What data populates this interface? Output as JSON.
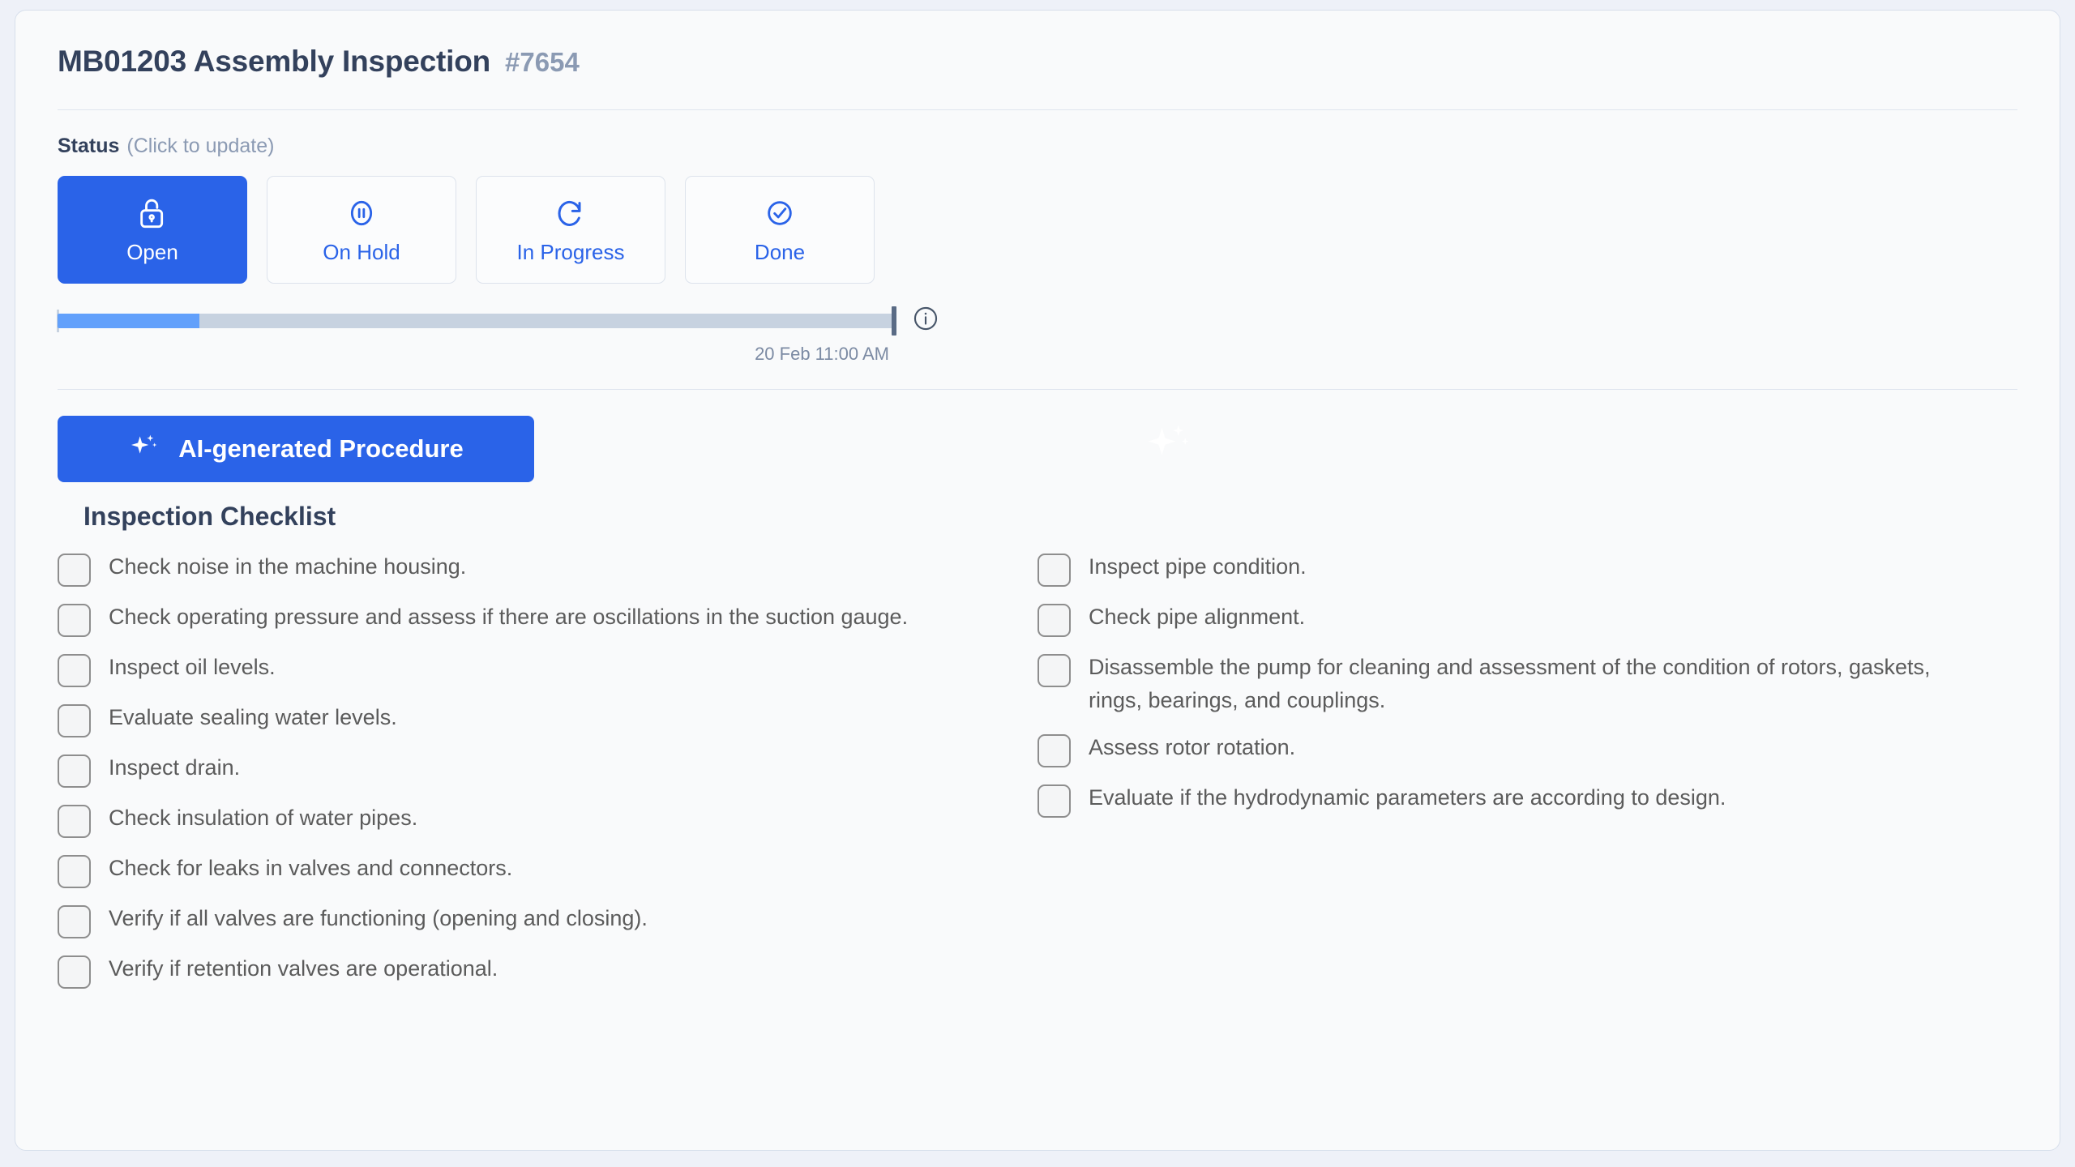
{
  "header": {
    "title": "MB01203 Assembly Inspection",
    "ticket": "#7654"
  },
  "status": {
    "label": "Status",
    "hint": "(Click to update)",
    "options": [
      {
        "label": "Open",
        "icon": "unlock-icon",
        "active": true
      },
      {
        "label": "On Hold",
        "icon": "pause-circle-icon",
        "active": false
      },
      {
        "label": "In Progress",
        "icon": "refresh-icon",
        "active": false
      },
      {
        "label": "Done",
        "icon": "check-circle-icon",
        "active": false
      }
    ],
    "accent_color": "#2a63e8",
    "progress": {
      "percent": 17,
      "fill_color": "#62a0fb",
      "track_color": "#c7d2e0",
      "due_label": "20 Feb 11:00 AM",
      "info_icon": "info-icon"
    }
  },
  "procedure": {
    "ai_button_label": "AI-generated Procedure",
    "ai_button_icon": "sparkle-icon",
    "watermark_icon": "sparkle-icon"
  },
  "checklist": {
    "heading": "Inspection Checklist",
    "left_items": [
      "Check noise in the machine housing.",
      "Check operating pressure and assess if there are oscillations in the suction gauge.",
      "Inspect oil levels.",
      "Evaluate sealing water levels.",
      "Inspect drain.",
      "Check insulation of water pipes.",
      "Check for leaks in valves and connectors.",
      "Verify if all valves are functioning (opening and closing).",
      "Verify if retention valves are operational."
    ],
    "right_items": [
      "Inspect pipe condition.",
      "Check pipe alignment.",
      "Disassemble the pump for cleaning and assessment of the condition of rotors, gaskets, rings, bearings, and couplings.",
      "Assess rotor rotation.",
      "Evaluate if the hydrodynamic parameters are according to design."
    ]
  }
}
